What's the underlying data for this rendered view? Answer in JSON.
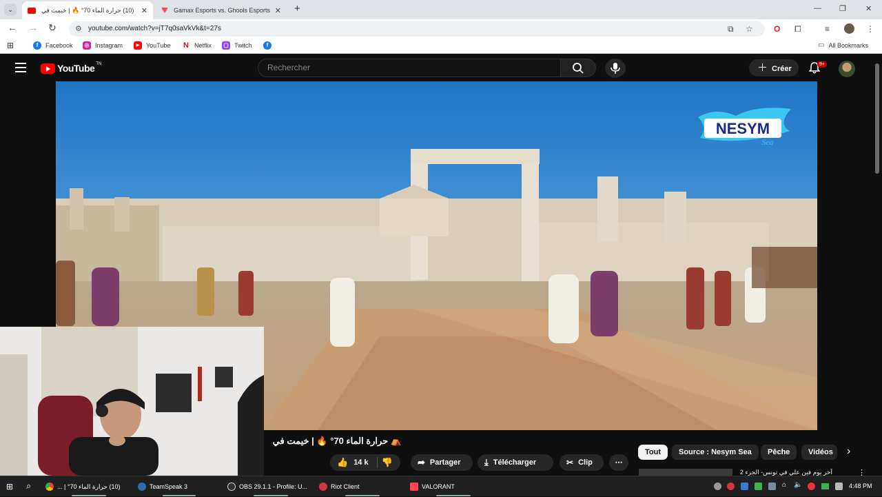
{
  "browser": {
    "tabs": [
      {
        "title": "(10) حرارة الماء 70° 🔥 | خيمت في",
        "active": true,
        "favicon_color": "#ff0000"
      },
      {
        "title": "Gamax Esports vs. Ghools Esports",
        "active": false,
        "favicon_color": "#ff4655"
      }
    ],
    "new_tab_label": "+",
    "url": "youtube.com/watch?v=jT7q0saVkVk&t=27s",
    "bookmarks": [
      {
        "label": "Facebook",
        "color": "#1877f2",
        "glyph": "f"
      },
      {
        "label": "Instagram",
        "color": "#d6249f",
        "glyph": "◎"
      },
      {
        "label": "YouTube",
        "color": "#ff0000",
        "glyph": "▶"
      },
      {
        "label": "Netflix",
        "color": "#e50914",
        "glyph": "N"
      },
      {
        "label": "Twitch",
        "color": "#9146ff",
        "glyph": "▢"
      },
      {
        "label": "",
        "color": "#1877f2",
        "glyph": "f"
      }
    ],
    "all_bookmarks_label": "All Bookmarks"
  },
  "youtube": {
    "logo_text": "YouTube",
    "logo_superscript": "TN",
    "search_placeholder": "Rechercher",
    "create_label": "Créer",
    "notification_count": "9+"
  },
  "video": {
    "watermark": "NESYM Sea",
    "title": "⛺ حرارة الماء 70° 🔥 | خيمت في",
    "likes": "14 k",
    "share_label": "Partager",
    "download_label": "Télécharger",
    "clip_label": "Clip",
    "more_label": "⋯"
  },
  "recommendations": {
    "chips": [
      {
        "label": "Tout",
        "selected": true
      },
      {
        "label": "Source : Nesym Sea",
        "selected": false
      },
      {
        "label": "Pêche",
        "selected": false
      },
      {
        "label": "Vidéos",
        "selected": false
      }
    ],
    "first_title": "آخر يوم فين علي في تونس- الجزء 2"
  },
  "taskbar": {
    "items": [
      {
        "label": "(10) حرارة الماء 70° | ...",
        "color": "#4285f4"
      },
      {
        "label": "TeamSpeak 3",
        "color": "#2a6db3"
      },
      {
        "label": "OBS 29.1.1 - Profile: U...",
        "color": "#302e31"
      },
      {
        "label": "Riot Client",
        "color": "#d13639"
      },
      {
        "label": "VALORANT",
        "color": "#ff4655"
      }
    ],
    "clock": "4:48 PM"
  }
}
